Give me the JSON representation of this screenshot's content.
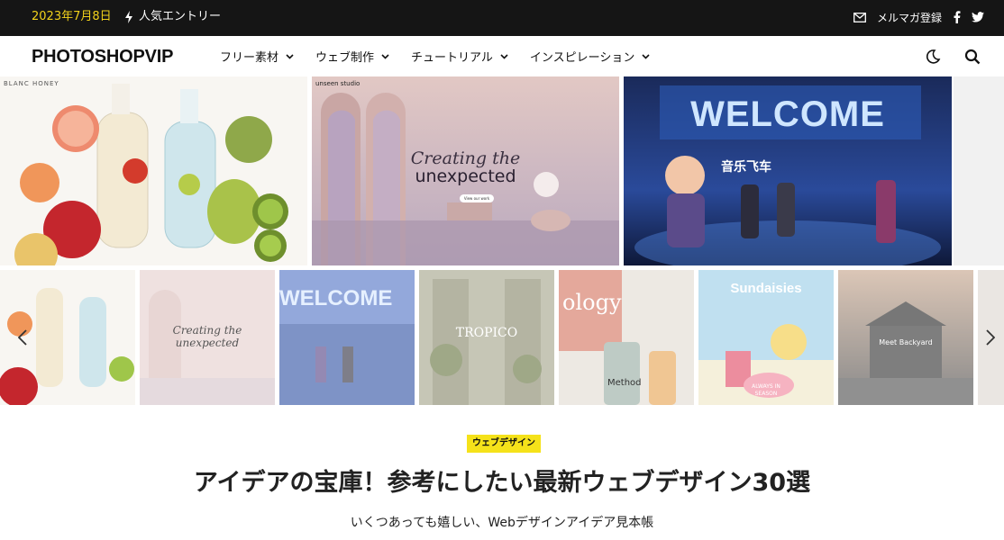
{
  "topbar": {
    "date": "2023年7月8日",
    "popular_label": "人気エントリー",
    "newsletter_label": "メルマガ登録",
    "icons": [
      "lightning-icon",
      "mail-icon",
      "facebook-icon",
      "twitter-icon"
    ],
    "accent_color": "#f2d21b"
  },
  "header": {
    "logo": "PHOTOSHOPVIP",
    "nav": [
      {
        "label": "フリー素材"
      },
      {
        "label": "ウェブ制作"
      },
      {
        "label": "チュートリアル"
      },
      {
        "label": "インスピレーション"
      }
    ],
    "tools": [
      "moon-icon",
      "search-icon"
    ]
  },
  "hero": {
    "slides": [
      {
        "brand": "BLANC HONEY"
      },
      {
        "brand": "unseen studio",
        "headline": "Creating the",
        "headline2": "unexpected",
        "button": "View our work"
      },
      {
        "headline": "WELCOME",
        "subheadline": "音乐飞车"
      }
    ]
  },
  "carousel": {
    "thumbs": [
      {
        "label": ""
      },
      {
        "label": "Creating the unexpected"
      },
      {
        "label": "WELCOME"
      },
      {
        "label": "TROPICO"
      },
      {
        "label": "ology"
      },
      {
        "label": "Sundaisies"
      },
      {
        "label": "Meet Backyard"
      }
    ],
    "sundaisies_tag": "ALWAYS IN SEASON",
    "methodic": "Method"
  },
  "article": {
    "category": "ウェブデザイン",
    "title": "アイデアの宝庫！参考にしたい最新ウェブデザイン30選",
    "subtitle": "いくつあっても嬉しい、Webデザインアイデア見本帳",
    "badge_color": "#f5e21a"
  }
}
